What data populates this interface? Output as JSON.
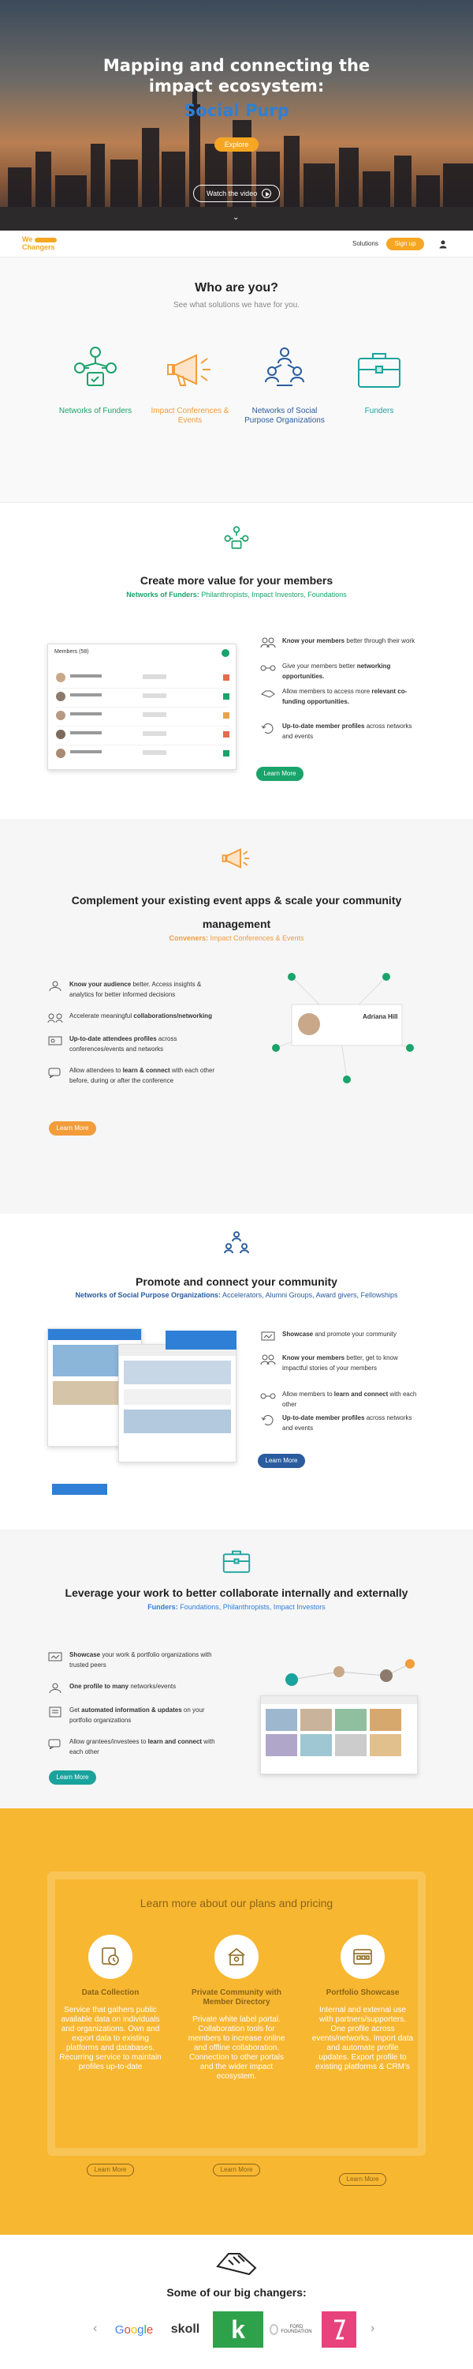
{
  "hero": {
    "title_line1": "Mapping and connecting the",
    "title_line2": "impact ecosystem:",
    "subtitle": "Social Purp",
    "explore_label": "Explore",
    "video_label": "Watch the video"
  },
  "nav": {
    "logo_line1": "We",
    "logo_line2": "Changers",
    "solutions": "Solutions",
    "signup": "Sign up"
  },
  "who": {
    "title": "Who are you?",
    "subtitle": "See what solutions we have for you.",
    "cards": [
      {
        "label": "Networks of Funders",
        "color": "#1aa36b"
      },
      {
        "label": "Impact Conferences & Events",
        "color": "#f39c3a"
      },
      {
        "label": "Networks of Social Purpose Organizations",
        "color": "#2a5c9e"
      },
      {
        "label": "Funders",
        "color": "#1aa39c"
      }
    ]
  },
  "funders_section": {
    "title": "Create more value for your members",
    "sub_label": "Networks of Funders:",
    "sub_rest": " Philanthropists, Impact Investors, Foundations",
    "features": [
      {
        "bold": "Know your members",
        "rest": " better through their work"
      },
      {
        "pre": "Give your members better ",
        "bold": "networking opportunities."
      },
      {
        "pre": "Allow members to access more ",
        "bold": "relevant co-funding opportunities."
      },
      {
        "bold": "Up-to-date member profiles",
        "rest": " across networks and events"
      }
    ],
    "button": "Learn More",
    "mock_header": "Members (58)"
  },
  "events_section": {
    "title": "Complement your existing event apps & scale your community management",
    "sub_label": "Conveners:",
    "sub_rest": " Impact Conferences & Events",
    "features": [
      {
        "bold": "Know your audience",
        "rest": " better. Access insights & analytics for better informed decisions"
      },
      {
        "pre": "Accelerate meaningful ",
        "bold": "collaborations/networking"
      },
      {
        "bold": "Up-to-date attendees profiles",
        "rest": " across conferences/events and networks"
      },
      {
        "pre": "Allow attendees to ",
        "bold": "learn & connect",
        "rest": " with each other before, during or after the conference"
      }
    ],
    "button": "Learn More",
    "profile_name": "Adriana Hill"
  },
  "spo_section": {
    "title": "Promote and connect your community",
    "sub_label": "Networks of Social Purpose Organizations:",
    "sub_rest": " Accelerators, Alumni Groups, Award givers, Fellowships",
    "features": [
      {
        "bold": "Showcase",
        "rest": " and promote your community"
      },
      {
        "pre": "",
        "bold": "Know your members",
        "rest": " better, get to know impactful stories of your members"
      },
      {
        "pre": "Allow members to ",
        "bold": "learn and connect",
        "rest": " with each other"
      },
      {
        "bold": "Up-to-date member profiles",
        "rest": " across networks and events"
      }
    ],
    "button": "Learn More"
  },
  "funders2_section": {
    "title": "Leverage your work to better collaborate internally and externally",
    "sub_label": "Funders:",
    "sub_rest": " Foundations, Philanthropists, Impact Investors",
    "features": [
      {
        "bold": "Showcase",
        "rest": " your work & portfolio organizations with trusted peers"
      },
      {
        "bold": "One profile to many",
        "rest": " networks/events"
      },
      {
        "pre": "Get ",
        "bold": "automated information & updates",
        "rest": " on your portfolio organizations"
      },
      {
        "pre": "Allow grantees/investees to ",
        "bold": "learn and connect",
        "rest": " with each other"
      }
    ],
    "button": "Learn More"
  },
  "pricing": {
    "title": "Learn more about our plans and pricing",
    "plans": [
      {
        "title": "Data Collection",
        "desc": "Service that gathers public available data on individuals and organizations. Own and export data to existing platforms and databases. Recurring service to maintain profiles up-to-date",
        "button": "Learn More"
      },
      {
        "title": "Private Community with Member Directory",
        "desc": "Private white label portal. Collaboration tools for members to increase online and offline collaboration. Connection to other portals and the wider impact ecosystem.",
        "button": "Learn More"
      },
      {
        "title": "Portfolio Showcase",
        "desc": "Internal and external use with partners/supporters. One profile across events/networks. Import data and automate profile updates. Export profile to existing platforms & CRM's",
        "button": "Learn More"
      }
    ]
  },
  "changers": {
    "title": "Some of our big changers:",
    "logos": [
      "Google",
      "skoll",
      "k",
      "FORD FOUNDATION",
      ""
    ]
  },
  "colors": {
    "orange": "#f6a623",
    "green": "#1aa36b",
    "blue": "#2a5c9e",
    "teal": "#1aa39c"
  }
}
